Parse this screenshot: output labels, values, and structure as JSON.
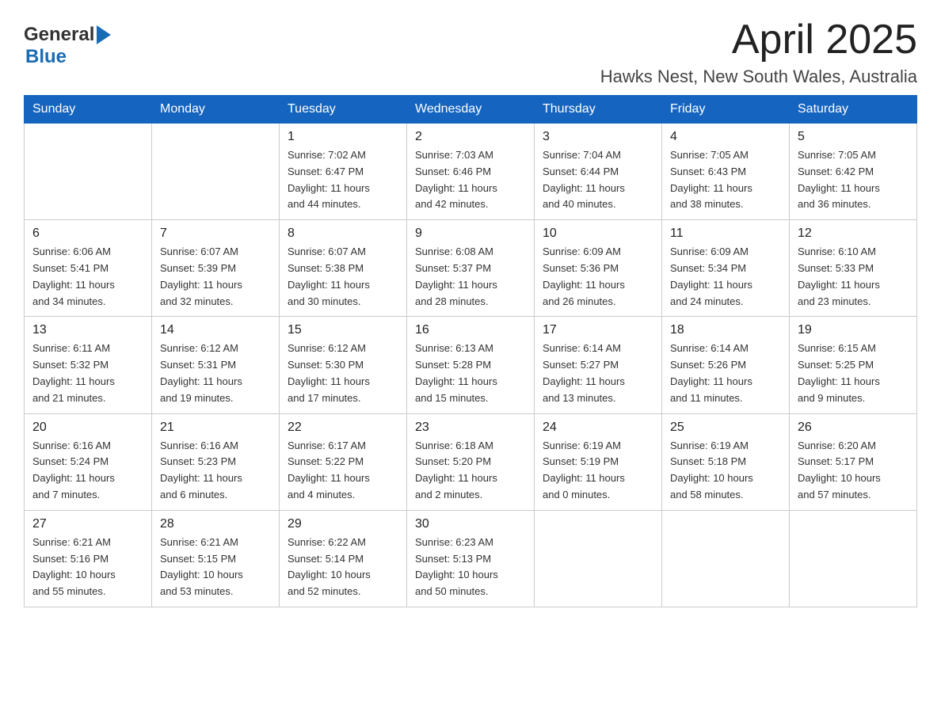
{
  "header": {
    "logo_general": "General",
    "logo_blue": "Blue",
    "title": "April 2025",
    "subtitle": "Hawks Nest, New South Wales, Australia"
  },
  "days_of_week": [
    "Sunday",
    "Monday",
    "Tuesday",
    "Wednesday",
    "Thursday",
    "Friday",
    "Saturday"
  ],
  "weeks": [
    {
      "days": [
        {
          "number": "",
          "info": ""
        },
        {
          "number": "",
          "info": ""
        },
        {
          "number": "1",
          "info": "Sunrise: 7:02 AM\nSunset: 6:47 PM\nDaylight: 11 hours\nand 44 minutes."
        },
        {
          "number": "2",
          "info": "Sunrise: 7:03 AM\nSunset: 6:46 PM\nDaylight: 11 hours\nand 42 minutes."
        },
        {
          "number": "3",
          "info": "Sunrise: 7:04 AM\nSunset: 6:44 PM\nDaylight: 11 hours\nand 40 minutes."
        },
        {
          "number": "4",
          "info": "Sunrise: 7:05 AM\nSunset: 6:43 PM\nDaylight: 11 hours\nand 38 minutes."
        },
        {
          "number": "5",
          "info": "Sunrise: 7:05 AM\nSunset: 6:42 PM\nDaylight: 11 hours\nand 36 minutes."
        }
      ]
    },
    {
      "days": [
        {
          "number": "6",
          "info": "Sunrise: 6:06 AM\nSunset: 5:41 PM\nDaylight: 11 hours\nand 34 minutes."
        },
        {
          "number": "7",
          "info": "Sunrise: 6:07 AM\nSunset: 5:39 PM\nDaylight: 11 hours\nand 32 minutes."
        },
        {
          "number": "8",
          "info": "Sunrise: 6:07 AM\nSunset: 5:38 PM\nDaylight: 11 hours\nand 30 minutes."
        },
        {
          "number": "9",
          "info": "Sunrise: 6:08 AM\nSunset: 5:37 PM\nDaylight: 11 hours\nand 28 minutes."
        },
        {
          "number": "10",
          "info": "Sunrise: 6:09 AM\nSunset: 5:36 PM\nDaylight: 11 hours\nand 26 minutes."
        },
        {
          "number": "11",
          "info": "Sunrise: 6:09 AM\nSunset: 5:34 PM\nDaylight: 11 hours\nand 24 minutes."
        },
        {
          "number": "12",
          "info": "Sunrise: 6:10 AM\nSunset: 5:33 PM\nDaylight: 11 hours\nand 23 minutes."
        }
      ]
    },
    {
      "days": [
        {
          "number": "13",
          "info": "Sunrise: 6:11 AM\nSunset: 5:32 PM\nDaylight: 11 hours\nand 21 minutes."
        },
        {
          "number": "14",
          "info": "Sunrise: 6:12 AM\nSunset: 5:31 PM\nDaylight: 11 hours\nand 19 minutes."
        },
        {
          "number": "15",
          "info": "Sunrise: 6:12 AM\nSunset: 5:30 PM\nDaylight: 11 hours\nand 17 minutes."
        },
        {
          "number": "16",
          "info": "Sunrise: 6:13 AM\nSunset: 5:28 PM\nDaylight: 11 hours\nand 15 minutes."
        },
        {
          "number": "17",
          "info": "Sunrise: 6:14 AM\nSunset: 5:27 PM\nDaylight: 11 hours\nand 13 minutes."
        },
        {
          "number": "18",
          "info": "Sunrise: 6:14 AM\nSunset: 5:26 PM\nDaylight: 11 hours\nand 11 minutes."
        },
        {
          "number": "19",
          "info": "Sunrise: 6:15 AM\nSunset: 5:25 PM\nDaylight: 11 hours\nand 9 minutes."
        }
      ]
    },
    {
      "days": [
        {
          "number": "20",
          "info": "Sunrise: 6:16 AM\nSunset: 5:24 PM\nDaylight: 11 hours\nand 7 minutes."
        },
        {
          "number": "21",
          "info": "Sunrise: 6:16 AM\nSunset: 5:23 PM\nDaylight: 11 hours\nand 6 minutes."
        },
        {
          "number": "22",
          "info": "Sunrise: 6:17 AM\nSunset: 5:22 PM\nDaylight: 11 hours\nand 4 minutes."
        },
        {
          "number": "23",
          "info": "Sunrise: 6:18 AM\nSunset: 5:20 PM\nDaylight: 11 hours\nand 2 minutes."
        },
        {
          "number": "24",
          "info": "Sunrise: 6:19 AM\nSunset: 5:19 PM\nDaylight: 11 hours\nand 0 minutes."
        },
        {
          "number": "25",
          "info": "Sunrise: 6:19 AM\nSunset: 5:18 PM\nDaylight: 10 hours\nand 58 minutes."
        },
        {
          "number": "26",
          "info": "Sunrise: 6:20 AM\nSunset: 5:17 PM\nDaylight: 10 hours\nand 57 minutes."
        }
      ]
    },
    {
      "days": [
        {
          "number": "27",
          "info": "Sunrise: 6:21 AM\nSunset: 5:16 PM\nDaylight: 10 hours\nand 55 minutes."
        },
        {
          "number": "28",
          "info": "Sunrise: 6:21 AM\nSunset: 5:15 PM\nDaylight: 10 hours\nand 53 minutes."
        },
        {
          "number": "29",
          "info": "Sunrise: 6:22 AM\nSunset: 5:14 PM\nDaylight: 10 hours\nand 52 minutes."
        },
        {
          "number": "30",
          "info": "Sunrise: 6:23 AM\nSunset: 5:13 PM\nDaylight: 10 hours\nand 50 minutes."
        },
        {
          "number": "",
          "info": ""
        },
        {
          "number": "",
          "info": ""
        },
        {
          "number": "",
          "info": ""
        }
      ]
    }
  ]
}
